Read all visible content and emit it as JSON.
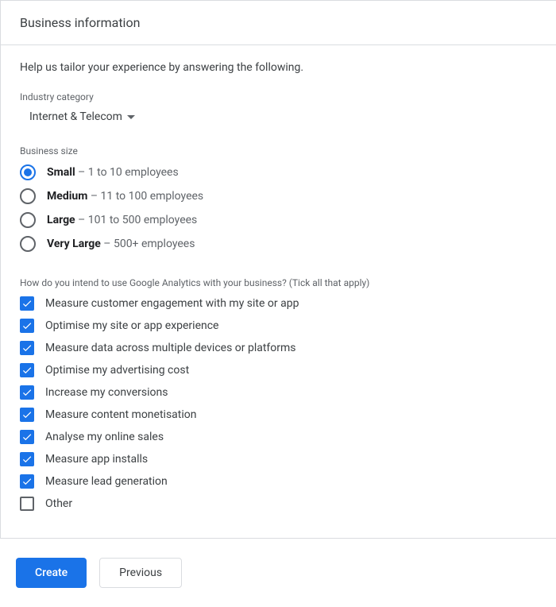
{
  "header": {
    "title": "Business information"
  },
  "intro": "Help us tailor your experience by answering the following.",
  "industry": {
    "label": "Industry category",
    "selected": "Internet & Telecom"
  },
  "business_size": {
    "label": "Business size",
    "options": [
      {
        "name": "Small",
        "desc": "1 to 10 employees",
        "selected": true
      },
      {
        "name": "Medium",
        "desc": "11 to 100 employees",
        "selected": false
      },
      {
        "name": "Large",
        "desc": "101 to 500 employees",
        "selected": false
      },
      {
        "name": "Very Large",
        "desc": "500+ employees",
        "selected": false
      }
    ]
  },
  "usage": {
    "label": "How do you intend to use Google Analytics with your business? (Tick all that apply)",
    "options": [
      {
        "label": "Measure customer engagement with my site or app",
        "checked": true
      },
      {
        "label": "Optimise my site or app experience",
        "checked": true
      },
      {
        "label": "Measure data across multiple devices or platforms",
        "checked": true
      },
      {
        "label": "Optimise my advertising cost",
        "checked": true
      },
      {
        "label": "Increase my conversions",
        "checked": true
      },
      {
        "label": "Measure content monetisation",
        "checked": true
      },
      {
        "label": "Analyse my online sales",
        "checked": true
      },
      {
        "label": "Measure app installs",
        "checked": true
      },
      {
        "label": "Measure lead generation",
        "checked": true
      },
      {
        "label": "Other",
        "checked": false
      }
    ]
  },
  "footer": {
    "create": "Create",
    "previous": "Previous"
  },
  "dash": " – "
}
